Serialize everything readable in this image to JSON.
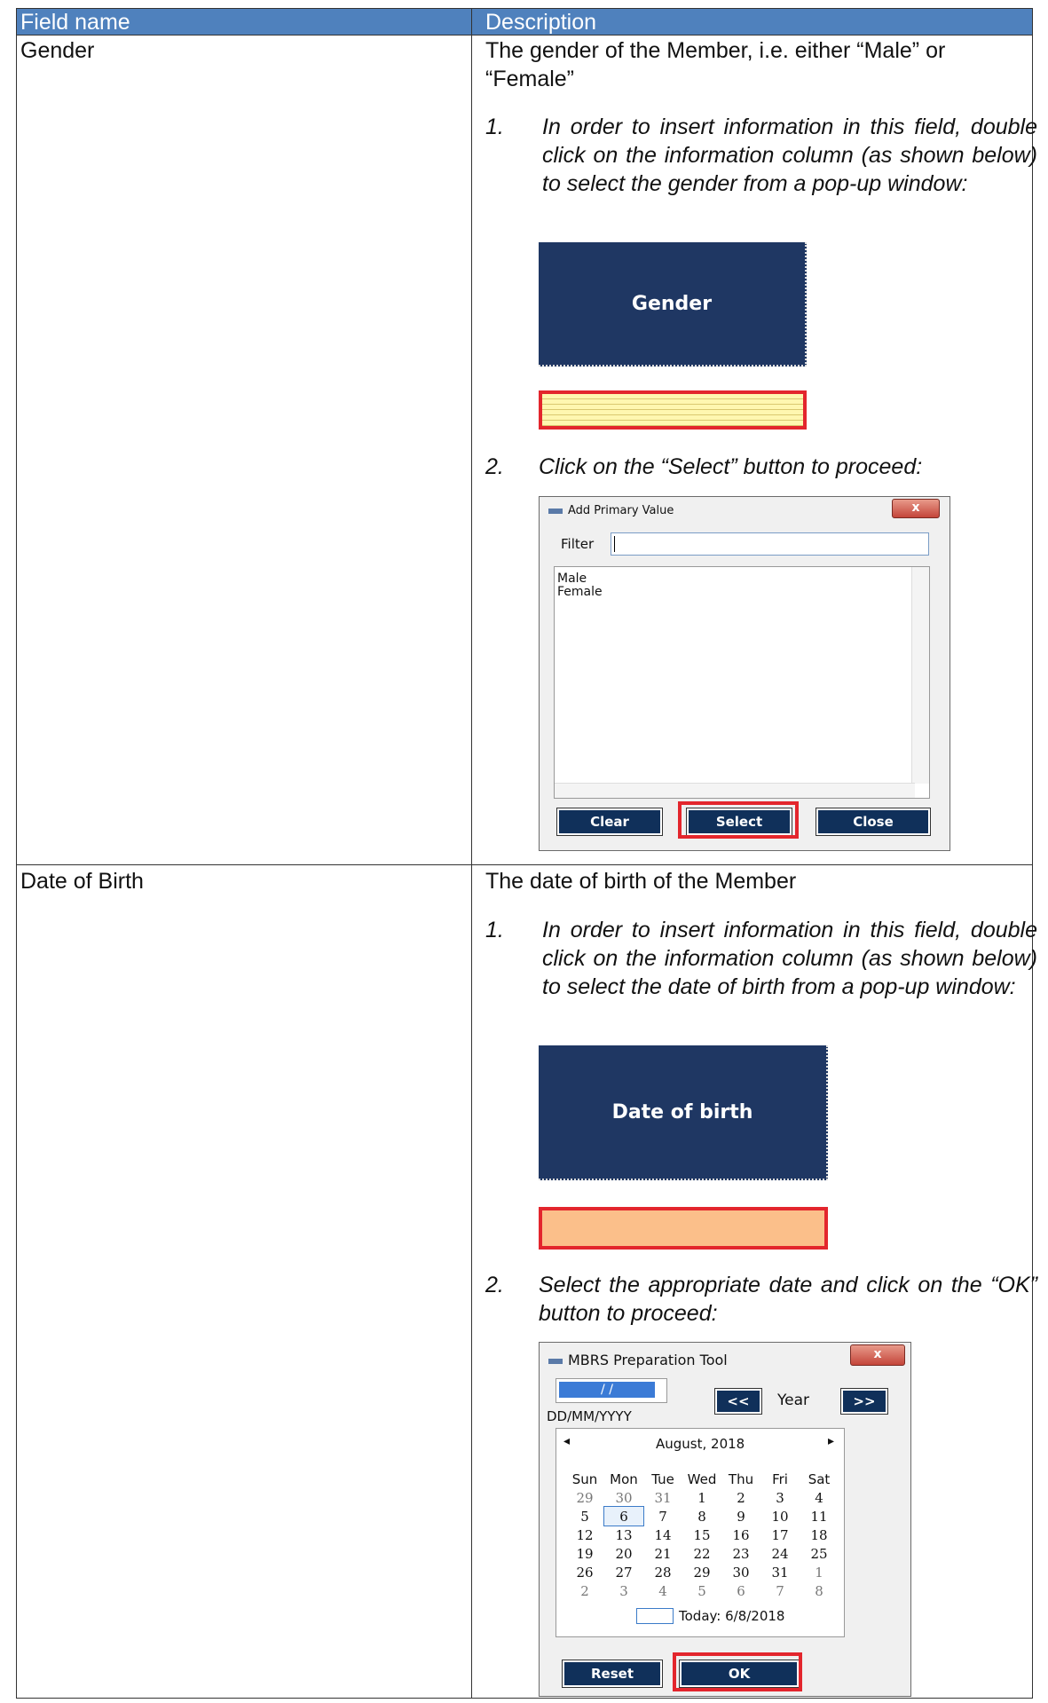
{
  "table": {
    "header": {
      "col1": "Field name",
      "col2": "Description"
    },
    "gender": {
      "field": "Gender",
      "desc_line1": "The gender of the Member, i.e. either “Male” or",
      "desc_line2": "“Female”",
      "step1_num": "1.",
      "step1_text": "In order to insert information in this field, double click on the information column (as shown below) to select the gender from a pop-up window:",
      "header_box": "Gender",
      "step2_num": "2.",
      "step2_text": "Click on the “Select” button to proceed:",
      "dialog": {
        "title": "Add Primary Value",
        "close_glyph": "x",
        "filter_label": "Filter",
        "filter_value": "",
        "options": [
          "Male",
          "Female"
        ],
        "buttons": {
          "clear": "Clear",
          "select": "Select",
          "close": "Close"
        }
      }
    },
    "dob": {
      "field": "Date of Birth",
      "desc": "The date of birth of the Member",
      "step1_num": "1.",
      "step1_text": "In order to insert information in this field, double click on the information column (as shown below) to select the date of birth from a pop-up window:",
      "header_box": "Date of birth",
      "step2_num": "2.",
      "step2_text": "Select the appropriate date and click on the “OK” button to proceed:",
      "dialog": {
        "title": "MBRS Preparation Tool",
        "close_glyph": "x",
        "date_input": " /  / ",
        "date_format": "DD/MM/YYYY",
        "prev_year": "<<",
        "year_label": "Year",
        "next_year": ">>",
        "prev_month": "◂",
        "month_label": "August, 2018",
        "next_month": "▸",
        "weekdays": [
          "Sun",
          "Mon",
          "Tue",
          "Wed",
          "Thu",
          "Fri",
          "Sat"
        ],
        "weeks": [
          [
            "29",
            "30",
            "31",
            "1",
            "2",
            "3",
            "4"
          ],
          [
            "5",
            "6",
            "7",
            "8",
            "9",
            "10",
            "11"
          ],
          [
            "12",
            "13",
            "14",
            "15",
            "16",
            "17",
            "18"
          ],
          [
            "19",
            "20",
            "21",
            "22",
            "23",
            "24",
            "25"
          ],
          [
            "26",
            "27",
            "28",
            "29",
            "30",
            "31",
            "1"
          ],
          [
            "2",
            "3",
            "4",
            "5",
            "6",
            "7",
            "8"
          ]
        ],
        "selected_day": "6",
        "today_label": "Today: 6/8/2018",
        "buttons": {
          "reset": "Reset",
          "ok": "OK"
        }
      }
    }
  }
}
